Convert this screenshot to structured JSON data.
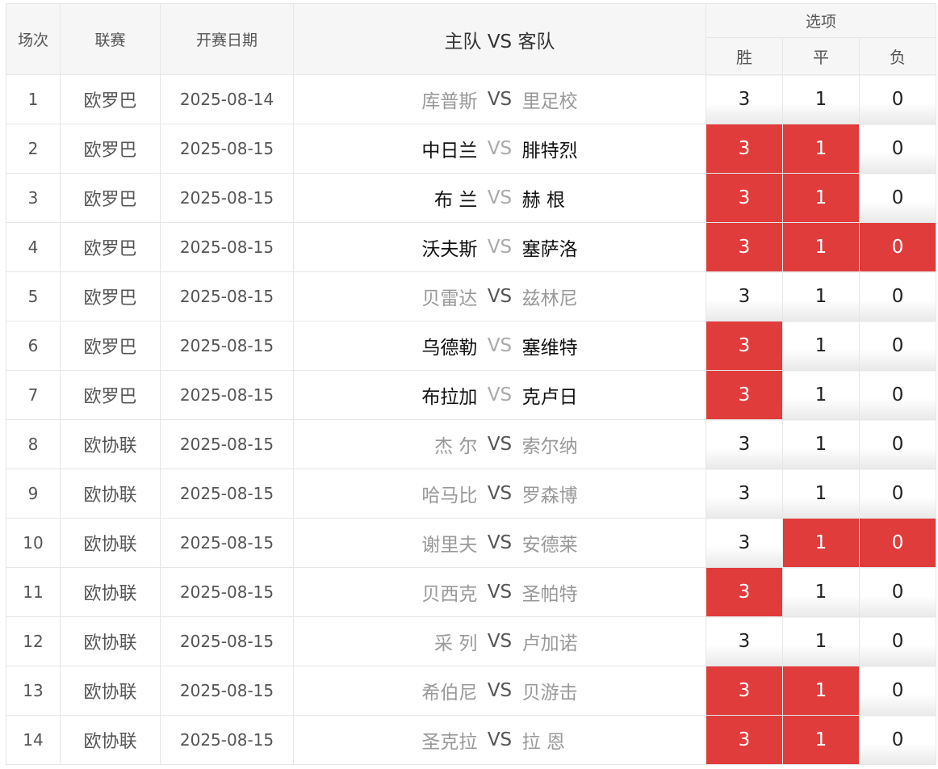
{
  "header": {
    "no": "场次",
    "league": "联赛",
    "date": "开赛日期",
    "match": "主队 VS 客队",
    "options": "选项",
    "win": "胜",
    "draw": "平",
    "lose": "负"
  },
  "colors": {
    "selected": "#e03c3c",
    "team_highlight": "#111111",
    "team_dim": "#999999"
  },
  "rows": [
    {
      "no": "1",
      "league": "欧罗巴",
      "date": "2025-08-14",
      "home": "库普斯",
      "vs": "VS",
      "away": "里足校",
      "o3": "3",
      "o1": "1",
      "o0": "0",
      "sel": [
        false,
        false,
        false
      ],
      "hl": false
    },
    {
      "no": "2",
      "league": "欧罗巴",
      "date": "2025-08-15",
      "home": "中日兰",
      "vs": "VS",
      "away": "腓特烈",
      "o3": "3",
      "o1": "1",
      "o0": "0",
      "sel": [
        true,
        true,
        false
      ],
      "hl": true
    },
    {
      "no": "3",
      "league": "欧罗巴",
      "date": "2025-08-15",
      "home": "布 兰",
      "vs": "VS",
      "away": "赫 根",
      "o3": "3",
      "o1": "1",
      "o0": "0",
      "sel": [
        true,
        true,
        false
      ],
      "hl": true
    },
    {
      "no": "4",
      "league": "欧罗巴",
      "date": "2025-08-15",
      "home": "沃夫斯",
      "vs": "VS",
      "away": "塞萨洛",
      "o3": "3",
      "o1": "1",
      "o0": "0",
      "sel": [
        true,
        true,
        true
      ],
      "hl": true
    },
    {
      "no": "5",
      "league": "欧罗巴",
      "date": "2025-08-15",
      "home": "贝雷达",
      "vs": "VS",
      "away": "兹林尼",
      "o3": "3",
      "o1": "1",
      "o0": "0",
      "sel": [
        false,
        false,
        false
      ],
      "hl": false
    },
    {
      "no": "6",
      "league": "欧罗巴",
      "date": "2025-08-15",
      "home": "乌德勒",
      "vs": "VS",
      "away": "塞维特",
      "o3": "3",
      "o1": "1",
      "o0": "0",
      "sel": [
        true,
        false,
        false
      ],
      "hl": true
    },
    {
      "no": "7",
      "league": "欧罗巴",
      "date": "2025-08-15",
      "home": "布拉加",
      "vs": "VS",
      "away": "克卢日",
      "o3": "3",
      "o1": "1",
      "o0": "0",
      "sel": [
        true,
        false,
        false
      ],
      "hl": true
    },
    {
      "no": "8",
      "league": "欧协联",
      "date": "2025-08-15",
      "home": "杰 尔",
      "vs": "VS",
      "away": "索尔纳",
      "o3": "3",
      "o1": "1",
      "o0": "0",
      "sel": [
        false,
        false,
        false
      ],
      "hl": false
    },
    {
      "no": "9",
      "league": "欧协联",
      "date": "2025-08-15",
      "home": "哈马比",
      "vs": "VS",
      "away": "罗森博",
      "o3": "3",
      "o1": "1",
      "o0": "0",
      "sel": [
        false,
        false,
        false
      ],
      "hl": false
    },
    {
      "no": "10",
      "league": "欧协联",
      "date": "2025-08-15",
      "home": "谢里夫",
      "vs": "VS",
      "away": "安德莱",
      "o3": "3",
      "o1": "1",
      "o0": "0",
      "sel": [
        false,
        true,
        true
      ],
      "hl": false
    },
    {
      "no": "11",
      "league": "欧协联",
      "date": "2025-08-15",
      "home": "贝西克",
      "vs": "VS",
      "away": "圣帕特",
      "o3": "3",
      "o1": "1",
      "o0": "0",
      "sel": [
        true,
        false,
        false
      ],
      "hl": false
    },
    {
      "no": "12",
      "league": "欧协联",
      "date": "2025-08-15",
      "home": "采 列",
      "vs": "VS",
      "away": "卢加诺",
      "o3": "3",
      "o1": "1",
      "o0": "0",
      "sel": [
        false,
        false,
        false
      ],
      "hl": false
    },
    {
      "no": "13",
      "league": "欧协联",
      "date": "2025-08-15",
      "home": "希伯尼",
      "vs": "VS",
      "away": "贝游击",
      "o3": "3",
      "o1": "1",
      "o0": "0",
      "sel": [
        true,
        true,
        false
      ],
      "hl": false
    },
    {
      "no": "14",
      "league": "欧协联",
      "date": "2025-08-15",
      "home": "圣克拉",
      "vs": "VS",
      "away": "拉 恩",
      "o3": "3",
      "o1": "1",
      "o0": "0",
      "sel": [
        true,
        true,
        false
      ],
      "hl": false
    }
  ]
}
